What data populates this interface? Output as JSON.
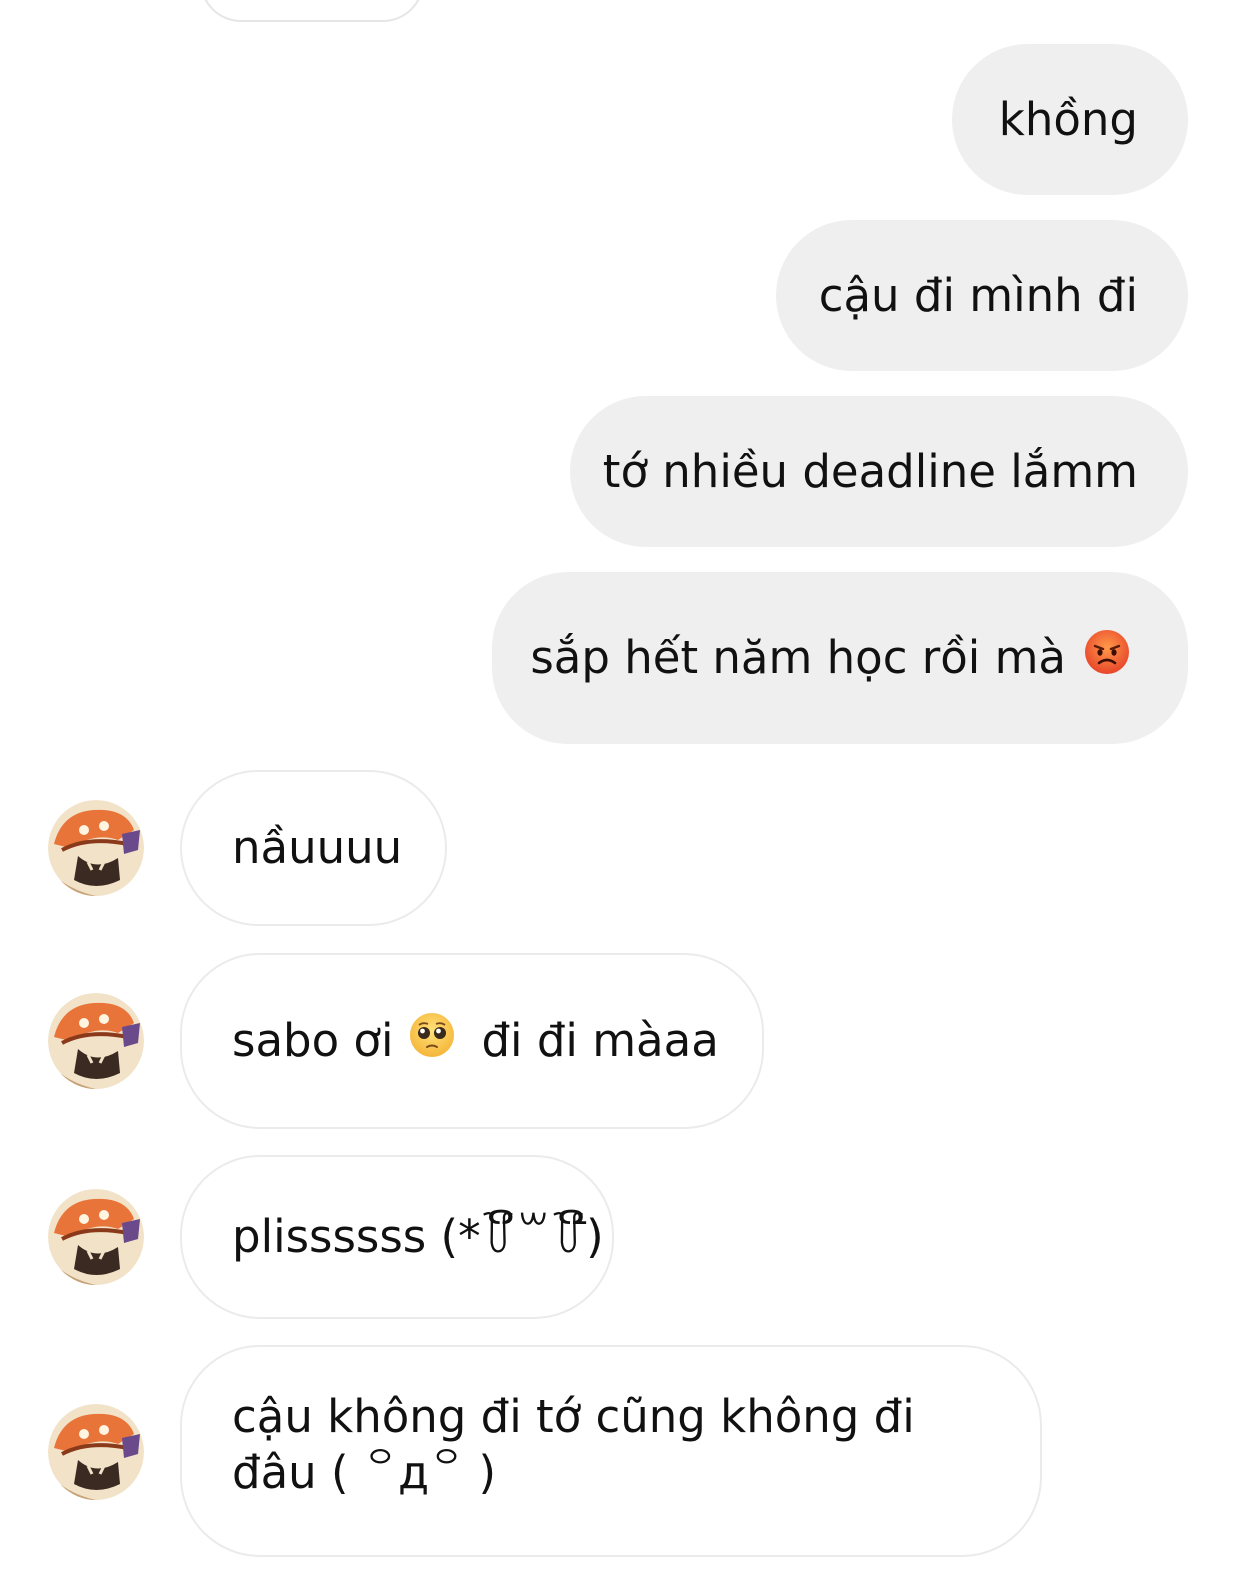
{
  "sent_messages": [
    {
      "text": "khồng"
    },
    {
      "text": "cậu đi mình đi"
    },
    {
      "text": "tớ nhiều deadline lắmm"
    },
    {
      "text": "sắp hết năm học rồi mà",
      "emoji": "pouting-face-emoji"
    }
  ],
  "received_messages": [
    {
      "text": "nầuuuu"
    },
    {
      "text_before": "sabo ơi",
      "emoji": "pleading-face-emoji",
      "text_after": "đi đi màaa"
    },
    {
      "text": "plissssss (*꒦ິ꒳꒦ີ)"
    },
    {
      "line1": "cậu không đi tớ cũng không đi",
      "line2": "đâu ( ꒪д꒪ )"
    }
  ],
  "avatar_icon": "anime-character-avatar-icon",
  "colors": {
    "sent_bubble": "#efefef",
    "received_border": "#ebebeb",
    "text": "#111111"
  }
}
